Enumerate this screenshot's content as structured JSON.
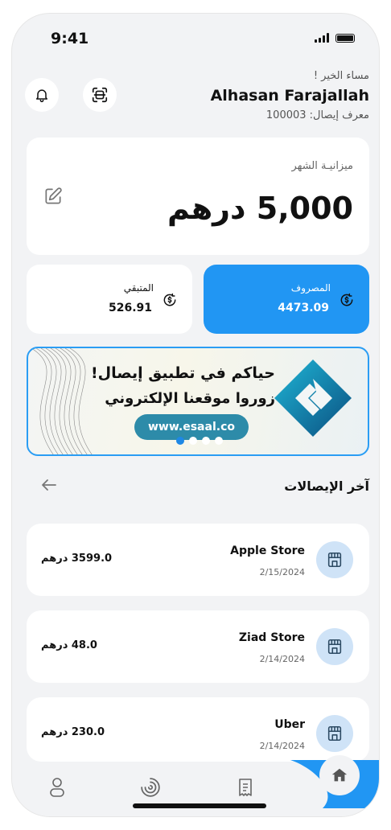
{
  "status": {
    "time": "9:41"
  },
  "header": {
    "greeting": "مساء الخير !",
    "user_name": "Alhasan Farajallah",
    "receipt_id": "معرف إيصال: 100003"
  },
  "budget": {
    "label": "ميزانيـة الشهر",
    "amount": "5,000 درهم"
  },
  "stats": {
    "spent_label": "المصروف",
    "spent_value": "4473.09",
    "remaining_label": "المتبقي",
    "remaining_value": "526.91"
  },
  "banner": {
    "line1": "حياكم في تطبيق إيصال!",
    "line2": "زوروا موقعنا الإلكتروني",
    "url": "www.esaal.co",
    "active_slide": 1
  },
  "recent": {
    "title": "آخر الإيصالات",
    "items": [
      {
        "name": "Apple Store",
        "date": "2/15/2024",
        "amount": "3599.0 درهم"
      },
      {
        "name": "Ziad Store",
        "date": "2/14/2024",
        "amount": "48.0 درهم"
      },
      {
        "name": "Uber",
        "date": "2/14/2024",
        "amount": "230.0 درهم"
      }
    ]
  },
  "colors": {
    "accent": "#2196F3",
    "store_icon_bg": "#cfe3f7",
    "banner_url_bg": "#2d8ba9"
  },
  "icons": [
    "bell-icon",
    "scan-icon",
    "edit-icon",
    "dollar-cycle-icon",
    "back-arrow-icon",
    "store-icon",
    "profile-icon",
    "chart-ring-icon",
    "receipt-icon",
    "home-icon"
  ]
}
